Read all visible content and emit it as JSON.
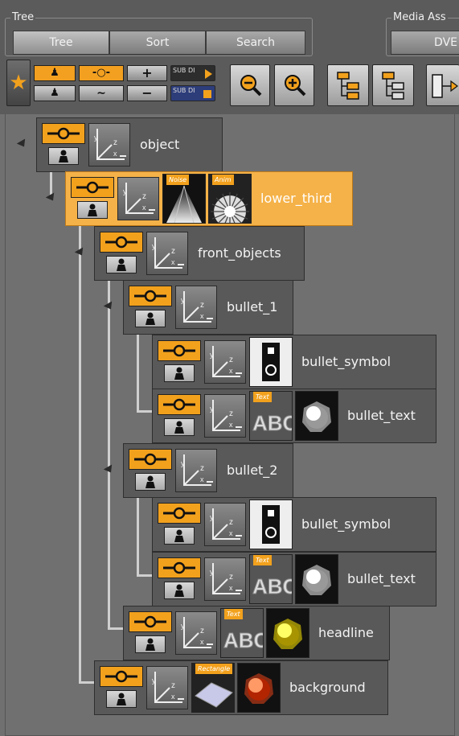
{
  "tree_group": {
    "title": "Tree",
    "tabs": [
      "Tree",
      "Sort",
      "Search"
    ],
    "selected_tab": "Tree"
  },
  "media_group": {
    "title": "Media Ass",
    "button": "DVE"
  },
  "toolbar": {
    "favorite_icon": "star-icon",
    "add_label": "+",
    "remove_label": "−",
    "sub_dir_label_1": "SUB DI",
    "sub_dir_label_2": "SUB DI",
    "zoom_out_icon": "zoom-out-icon",
    "zoom_in_icon": "zoom-in-icon",
    "expand_icon": "tree-expand-icon",
    "collapse_icon": "tree-collapse-icon"
  },
  "tree": {
    "nodes": [
      {
        "label": "object",
        "level": 0,
        "selected": false,
        "thumbs": []
      },
      {
        "label": "lower_third",
        "level": 1,
        "selected": true,
        "thumbs": [
          {
            "tag": "Noise",
            "kind": "noise"
          },
          {
            "tag": "Anim",
            "kind": "anim"
          }
        ]
      },
      {
        "label": "front_objects",
        "level": 2,
        "selected": false,
        "thumbs": []
      },
      {
        "label": "bullet_1",
        "level": 3,
        "selected": false,
        "thumbs": []
      },
      {
        "label": "bullet_symbol",
        "level": 4,
        "selected": false,
        "thumbs": [
          {
            "tag": "",
            "kind": "symbol"
          }
        ]
      },
      {
        "label": "bullet_text",
        "level": 4,
        "selected": false,
        "thumbs": [
          {
            "tag": "Text",
            "kind": "text"
          },
          {
            "tag": "",
            "kind": "sphere-white"
          }
        ]
      },
      {
        "label": "bullet_2",
        "level": 3,
        "selected": false,
        "thumbs": []
      },
      {
        "label": "bullet_symbol",
        "level": 4,
        "selected": false,
        "thumbs": [
          {
            "tag": "",
            "kind": "symbol"
          }
        ]
      },
      {
        "label": "bullet_text",
        "level": 4,
        "selected": false,
        "thumbs": [
          {
            "tag": "Text",
            "kind": "text"
          },
          {
            "tag": "",
            "kind": "sphere-white"
          }
        ]
      },
      {
        "label": "headline",
        "level": 3,
        "selected": false,
        "thumbs": [
          {
            "tag": "Text",
            "kind": "text"
          },
          {
            "tag": "",
            "kind": "sphere-yellow"
          }
        ]
      },
      {
        "label": "background",
        "level": 2,
        "selected": false,
        "thumbs": [
          {
            "tag": "Rectangle",
            "kind": "rectangle"
          },
          {
            "tag": "",
            "kind": "sphere-red"
          }
        ]
      }
    ]
  },
  "colors": {
    "accent": "#f2a11d",
    "selected_node": "#f5b248",
    "node_bg": "#595959",
    "panel_bg": "#707070"
  }
}
